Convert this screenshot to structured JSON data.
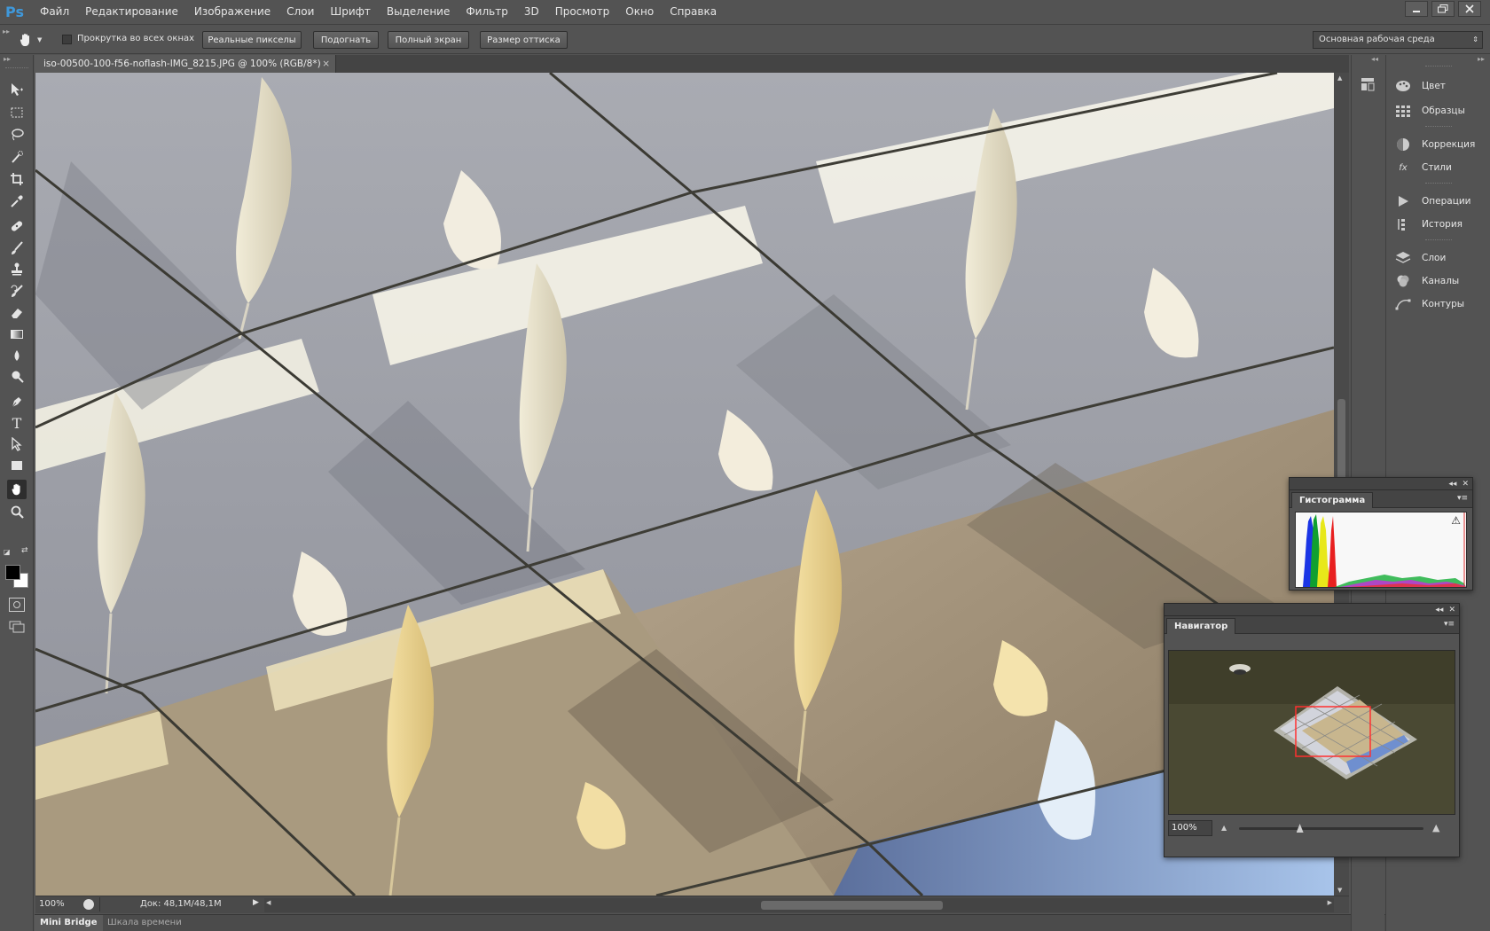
{
  "app": {
    "logo": "Ps"
  },
  "menu": [
    "Файл",
    "Редактирование",
    "Изображение",
    "Слои",
    "Шрифт",
    "Выделение",
    "Фильтр",
    "3D",
    "Просмотр",
    "Окно",
    "Справка"
  ],
  "window_buttons": [
    "minimize-icon",
    "restore-icon",
    "close-icon"
  ],
  "options": {
    "scroll_all_label": "Прокрутка во всех окнах",
    "scroll_all_checked": false,
    "buttons": [
      "Реальные пикселы",
      "Подогнать",
      "Полный экран",
      "Размер оттиска"
    ],
    "workspace": "Основная рабочая среда"
  },
  "document": {
    "tab_title": "iso-00500-100-f56-noflash-IMG_8215.JPG @ 100% (RGB/8*)",
    "close_glyph": "×",
    "zoom": "100%",
    "doc_size": "Док: 48,1M/48,1M"
  },
  "tools": [
    "move-tool",
    "marquee-tool",
    "lasso-tool",
    "quick-select-tool",
    "crop-tool",
    "eyedropper-tool",
    "healing-brush-tool",
    "brush-tool",
    "clone-stamp-tool",
    "history-brush-tool",
    "eraser-tool",
    "gradient-tool",
    "blur-tool",
    "dodge-tool",
    "pen-tool",
    "type-tool",
    "path-select-tool",
    "shape-tool",
    "hand-tool",
    "zoom-tool"
  ],
  "colors": {
    "foreground": "#000000",
    "background": "#ffffff",
    "accent": "#3f98db"
  },
  "dock": {
    "groups": [
      [
        {
          "label": "Цвет",
          "icon": "palette-icon"
        },
        {
          "label": "Образцы",
          "icon": "swatches-icon"
        }
      ],
      [
        {
          "label": "Коррекция",
          "icon": "adjustments-icon"
        },
        {
          "label": "Стили",
          "icon": "styles-icon"
        }
      ],
      [
        {
          "label": "Операции",
          "icon": "play-icon"
        },
        {
          "label": "История",
          "icon": "history-icon"
        }
      ],
      [
        {
          "label": "Слои",
          "icon": "layers-icon"
        },
        {
          "label": "Каналы",
          "icon": "channels-icon"
        },
        {
          "label": "Контуры",
          "icon": "paths-icon"
        }
      ]
    ]
  },
  "histogram_panel": {
    "title": "Гистограмма",
    "warning_glyph": "⚠"
  },
  "navigator_panel": {
    "title": "Навигатор",
    "zoom": "100%",
    "slider_value": 0.33
  },
  "bottom_tabs": [
    "Mini Bridge",
    "Шкала времени"
  ]
}
